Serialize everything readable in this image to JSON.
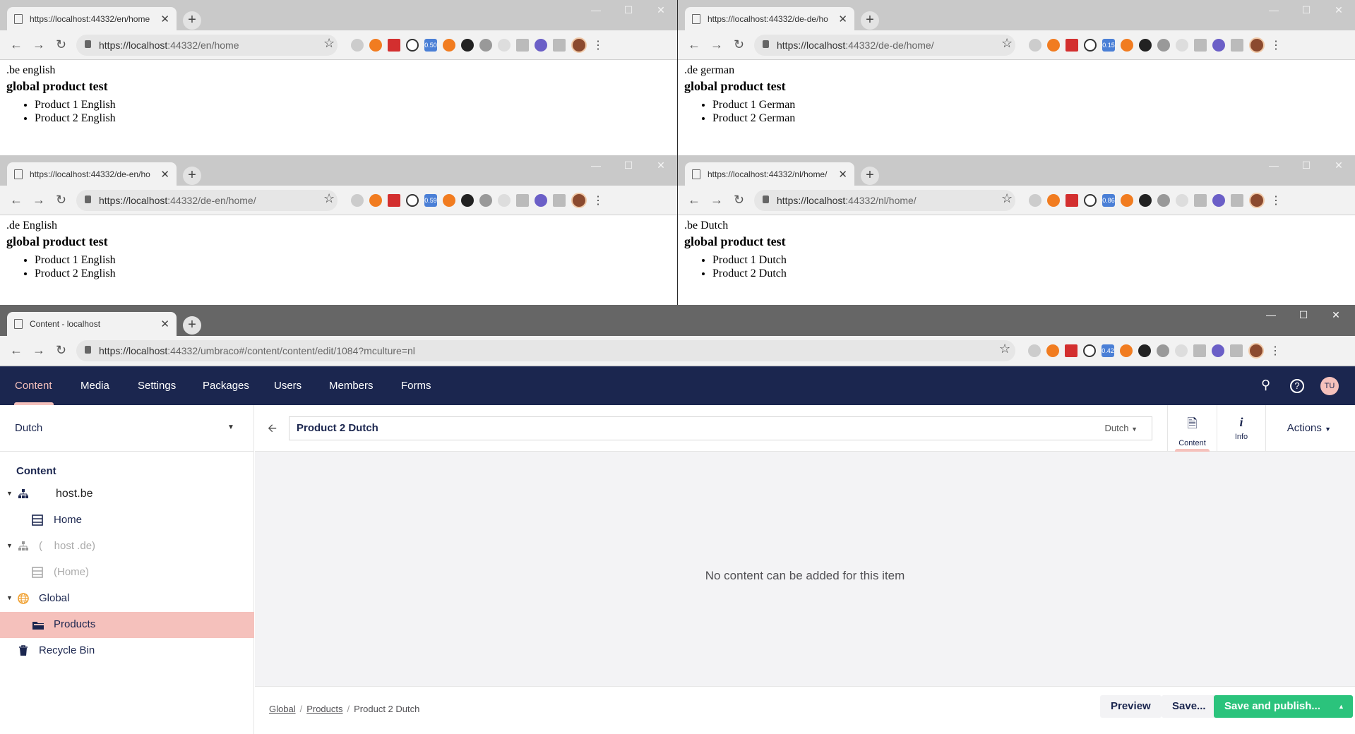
{
  "windows": [
    {
      "tab_title": "https://localhost:44332/en/home",
      "url_host": "https://localhost",
      "url_rest": ":44332/en/home",
      "badge": "0.50",
      "line1": ".be english",
      "heading": "global product test",
      "items": [
        "Product 1 English",
        "Product 2 English"
      ]
    },
    {
      "tab_title": "https://localhost:44332/de-de/ho",
      "url_host": "https://localhost",
      "url_rest": ":44332/de-de/home/",
      "badge": "0.15",
      "line1": ".de german",
      "heading": "global product test",
      "items": [
        "Product 1 German",
        "Product 2 German"
      ]
    },
    {
      "tab_title": "https://localhost:44332/de-en/ho",
      "url_host": "https://localhost",
      "url_rest": ":44332/de-en/home/",
      "badge": "0.59",
      "line1": ".de English",
      "heading": "global product test",
      "items": [
        "Product 1 English",
        "Product 2 English"
      ]
    },
    {
      "tab_title": "https://localhost:44332/nl/home/",
      "url_host": "https://localhost",
      "url_rest": ":44332/nl/home/",
      "badge": "0.86",
      "line1": ".be Dutch",
      "heading": "global product test",
      "items": [
        "Product 1 Dutch",
        "Product 2 Dutch"
      ]
    }
  ],
  "main": {
    "tab_title": "Content - localhost",
    "url_host": "https://localhost",
    "url_rest": ":44332/umbraco#/content/content/edit/1084?mculture=nl",
    "badge": "0.42",
    "nav": [
      "Content",
      "Media",
      "Settings",
      "Packages",
      "Users",
      "Members",
      "Forms"
    ],
    "user_initials": "TU",
    "language": "Dutch",
    "section_title": "Content",
    "tree": [
      {
        "label": "host.be"
      },
      {
        "label": "Home"
      },
      {
        "label": "(    host .de)"
      },
      {
        "label": "(Home)"
      },
      {
        "label": "Global"
      },
      {
        "label": "Products"
      },
      {
        "label": "Recycle Bin"
      }
    ],
    "node_name": "Product 2 Dutch",
    "node_lang": "Dutch",
    "apps": [
      "Content",
      "Info"
    ],
    "actions_label": "Actions",
    "empty_message": "No content can be added for this item",
    "breadcrumb": [
      "Global",
      "Products",
      "Product 2 Dutch"
    ],
    "buttons": {
      "preview": "Preview",
      "save": "Save...",
      "publish": "Save and publish..."
    }
  }
}
